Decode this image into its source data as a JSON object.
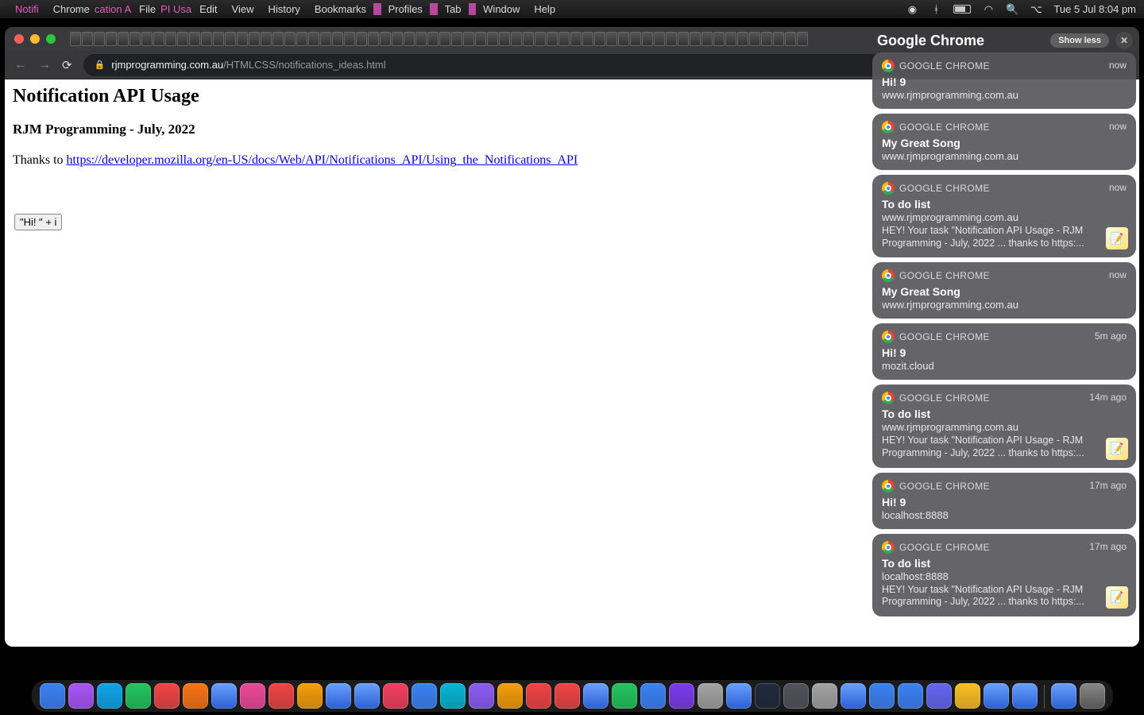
{
  "menubar": {
    "left_pink_pre": "Notifi",
    "items": [
      "Chrome",
      "File",
      "Edit",
      "View",
      "History",
      "Bookmarks",
      "Profiles",
      "Tab",
      "Window",
      "Help"
    ],
    "pink_overlay_between": "cation  A",
    "pink_after_file": "PI Usa",
    "time": "Tue 5 Jul  8:04 pm"
  },
  "toolbar": {
    "url_host": "rjmprogramming.com.au",
    "url_path": "/HTMLCSS/notifications_ideas.html"
  },
  "page": {
    "h1": "Notification API Usage",
    "h3": "RJM Programming - July, 2022",
    "thanks_pre": "Thanks to ",
    "thanks_link": "https://developer.mozilla.org/en-US/docs/Web/API/Notifications_API/Using_the_Notifications_API",
    "button_label": "\"Hi! \" + i"
  },
  "nc": {
    "title": "Google Chrome",
    "show_less": "Show less",
    "app_label": "GOOGLE CHROME",
    "items": [
      {
        "time": "now",
        "title": "Hi! 9",
        "site": "www.rjmprogramming.com.au",
        "body": "",
        "thumb": false
      },
      {
        "time": "now",
        "title": "My Great Song",
        "site": "www.rjmprogramming.com.au",
        "body": "",
        "thumb": false
      },
      {
        "time": "now",
        "title": "To do list",
        "site": "www.rjmprogramming.com.au",
        "body": "HEY! Your task \"Notification API Usage - RJM Programming - July, 2022 ... thanks to https:...",
        "thumb": true
      },
      {
        "time": "now",
        "title": "My Great Song",
        "site": "www.rjmprogramming.com.au",
        "body": "",
        "thumb": false
      },
      {
        "time": "5m ago",
        "title": "Hi! 9",
        "site": "mozit.cloud",
        "body": "",
        "thumb": false
      },
      {
        "time": "14m ago",
        "title": "To do list",
        "site": "www.rjmprogramming.com.au",
        "body": "HEY! Your task \"Notification API Usage - RJM Programming - July, 2022 ... thanks to https:...",
        "thumb": true
      },
      {
        "time": "17m ago",
        "title": "Hi! 9",
        "site": "localhost:8888",
        "body": "",
        "thumb": false
      },
      {
        "time": "17m ago",
        "title": "To do list",
        "site": "localhost:8888",
        "body": "HEY! Your task \"Notification API Usage - RJM Programming - July, 2022 ... thanks to https:...",
        "thumb": true
      }
    ]
  }
}
